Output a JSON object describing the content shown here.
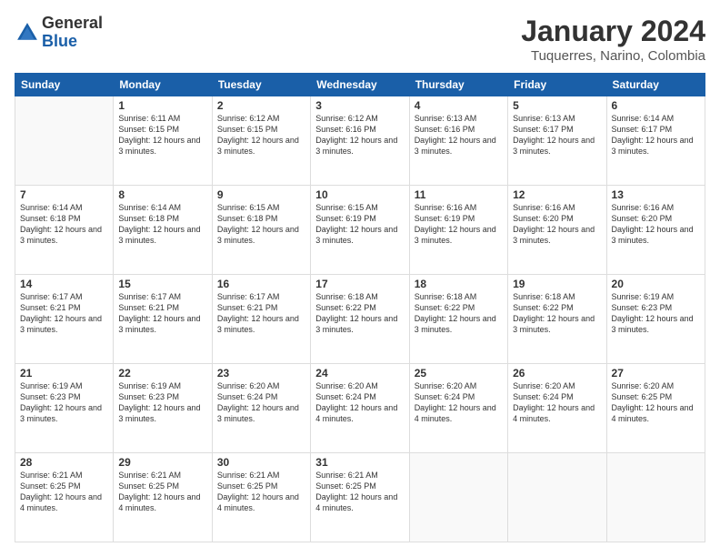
{
  "logo": {
    "general": "General",
    "blue": "Blue"
  },
  "header": {
    "month": "January 2024",
    "location": "Tuquerres, Narino, Colombia"
  },
  "weekdays": [
    "Sunday",
    "Monday",
    "Tuesday",
    "Wednesday",
    "Thursday",
    "Friday",
    "Saturday"
  ],
  "weeks": [
    [
      {
        "day": "",
        "sunrise": "",
        "sunset": "",
        "daylight": ""
      },
      {
        "day": "1",
        "sunrise": "Sunrise: 6:11 AM",
        "sunset": "Sunset: 6:15 PM",
        "daylight": "Daylight: 12 hours and 3 minutes."
      },
      {
        "day": "2",
        "sunrise": "Sunrise: 6:12 AM",
        "sunset": "Sunset: 6:15 PM",
        "daylight": "Daylight: 12 hours and 3 minutes."
      },
      {
        "day": "3",
        "sunrise": "Sunrise: 6:12 AM",
        "sunset": "Sunset: 6:16 PM",
        "daylight": "Daylight: 12 hours and 3 minutes."
      },
      {
        "day": "4",
        "sunrise": "Sunrise: 6:13 AM",
        "sunset": "Sunset: 6:16 PM",
        "daylight": "Daylight: 12 hours and 3 minutes."
      },
      {
        "day": "5",
        "sunrise": "Sunrise: 6:13 AM",
        "sunset": "Sunset: 6:17 PM",
        "daylight": "Daylight: 12 hours and 3 minutes."
      },
      {
        "day": "6",
        "sunrise": "Sunrise: 6:14 AM",
        "sunset": "Sunset: 6:17 PM",
        "daylight": "Daylight: 12 hours and 3 minutes."
      }
    ],
    [
      {
        "day": "7",
        "sunrise": "Sunrise: 6:14 AM",
        "sunset": "Sunset: 6:18 PM",
        "daylight": "Daylight: 12 hours and 3 minutes."
      },
      {
        "day": "8",
        "sunrise": "Sunrise: 6:14 AM",
        "sunset": "Sunset: 6:18 PM",
        "daylight": "Daylight: 12 hours and 3 minutes."
      },
      {
        "day": "9",
        "sunrise": "Sunrise: 6:15 AM",
        "sunset": "Sunset: 6:18 PM",
        "daylight": "Daylight: 12 hours and 3 minutes."
      },
      {
        "day": "10",
        "sunrise": "Sunrise: 6:15 AM",
        "sunset": "Sunset: 6:19 PM",
        "daylight": "Daylight: 12 hours and 3 minutes."
      },
      {
        "day": "11",
        "sunrise": "Sunrise: 6:16 AM",
        "sunset": "Sunset: 6:19 PM",
        "daylight": "Daylight: 12 hours and 3 minutes."
      },
      {
        "day": "12",
        "sunrise": "Sunrise: 6:16 AM",
        "sunset": "Sunset: 6:20 PM",
        "daylight": "Daylight: 12 hours and 3 minutes."
      },
      {
        "day": "13",
        "sunrise": "Sunrise: 6:16 AM",
        "sunset": "Sunset: 6:20 PM",
        "daylight": "Daylight: 12 hours and 3 minutes."
      }
    ],
    [
      {
        "day": "14",
        "sunrise": "Sunrise: 6:17 AM",
        "sunset": "Sunset: 6:21 PM",
        "daylight": "Daylight: 12 hours and 3 minutes."
      },
      {
        "day": "15",
        "sunrise": "Sunrise: 6:17 AM",
        "sunset": "Sunset: 6:21 PM",
        "daylight": "Daylight: 12 hours and 3 minutes."
      },
      {
        "day": "16",
        "sunrise": "Sunrise: 6:17 AM",
        "sunset": "Sunset: 6:21 PM",
        "daylight": "Daylight: 12 hours and 3 minutes."
      },
      {
        "day": "17",
        "sunrise": "Sunrise: 6:18 AM",
        "sunset": "Sunset: 6:22 PM",
        "daylight": "Daylight: 12 hours and 3 minutes."
      },
      {
        "day": "18",
        "sunrise": "Sunrise: 6:18 AM",
        "sunset": "Sunset: 6:22 PM",
        "daylight": "Daylight: 12 hours and 3 minutes."
      },
      {
        "day": "19",
        "sunrise": "Sunrise: 6:18 AM",
        "sunset": "Sunset: 6:22 PM",
        "daylight": "Daylight: 12 hours and 3 minutes."
      },
      {
        "day": "20",
        "sunrise": "Sunrise: 6:19 AM",
        "sunset": "Sunset: 6:23 PM",
        "daylight": "Daylight: 12 hours and 3 minutes."
      }
    ],
    [
      {
        "day": "21",
        "sunrise": "Sunrise: 6:19 AM",
        "sunset": "Sunset: 6:23 PM",
        "daylight": "Daylight: 12 hours and 3 minutes."
      },
      {
        "day": "22",
        "sunrise": "Sunrise: 6:19 AM",
        "sunset": "Sunset: 6:23 PM",
        "daylight": "Daylight: 12 hours and 3 minutes."
      },
      {
        "day": "23",
        "sunrise": "Sunrise: 6:20 AM",
        "sunset": "Sunset: 6:24 PM",
        "daylight": "Daylight: 12 hours and 3 minutes."
      },
      {
        "day": "24",
        "sunrise": "Sunrise: 6:20 AM",
        "sunset": "Sunset: 6:24 PM",
        "daylight": "Daylight: 12 hours and 4 minutes."
      },
      {
        "day": "25",
        "sunrise": "Sunrise: 6:20 AM",
        "sunset": "Sunset: 6:24 PM",
        "daylight": "Daylight: 12 hours and 4 minutes."
      },
      {
        "day": "26",
        "sunrise": "Sunrise: 6:20 AM",
        "sunset": "Sunset: 6:24 PM",
        "daylight": "Daylight: 12 hours and 4 minutes."
      },
      {
        "day": "27",
        "sunrise": "Sunrise: 6:20 AM",
        "sunset": "Sunset: 6:25 PM",
        "daylight": "Daylight: 12 hours and 4 minutes."
      }
    ],
    [
      {
        "day": "28",
        "sunrise": "Sunrise: 6:21 AM",
        "sunset": "Sunset: 6:25 PM",
        "daylight": "Daylight: 12 hours and 4 minutes."
      },
      {
        "day": "29",
        "sunrise": "Sunrise: 6:21 AM",
        "sunset": "Sunset: 6:25 PM",
        "daylight": "Daylight: 12 hours and 4 minutes."
      },
      {
        "day": "30",
        "sunrise": "Sunrise: 6:21 AM",
        "sunset": "Sunset: 6:25 PM",
        "daylight": "Daylight: 12 hours and 4 minutes."
      },
      {
        "day": "31",
        "sunrise": "Sunrise: 6:21 AM",
        "sunset": "Sunset: 6:25 PM",
        "daylight": "Daylight: 12 hours and 4 minutes."
      },
      {
        "day": "",
        "sunrise": "",
        "sunset": "",
        "daylight": ""
      },
      {
        "day": "",
        "sunrise": "",
        "sunset": "",
        "daylight": ""
      },
      {
        "day": "",
        "sunrise": "",
        "sunset": "",
        "daylight": ""
      }
    ]
  ]
}
